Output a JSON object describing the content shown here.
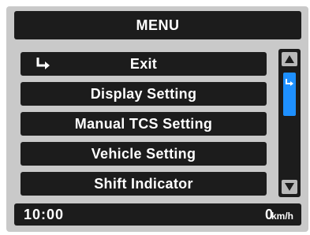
{
  "menu": {
    "title": "MENU",
    "items": [
      {
        "label": "Exit",
        "icon": "return-arrow-icon"
      },
      {
        "label": "Display Setting"
      },
      {
        "label": "Manual TCS Setting"
      },
      {
        "label": "Vehicle Setting"
      },
      {
        "label": "Shift Indicator"
      }
    ]
  },
  "scrollbar": {
    "up_icon": "triangle-up-icon",
    "down_icon": "triangle-down-icon",
    "thumb_icon": "return-arrow-icon",
    "thumb_color": "#1e90ff"
  },
  "status": {
    "time": "10:00",
    "speed": "0",
    "unit": "km/h"
  },
  "colors": {
    "background": "#c9c9c9",
    "bar": "#1c1c1c",
    "accent": "#1e90ff"
  }
}
